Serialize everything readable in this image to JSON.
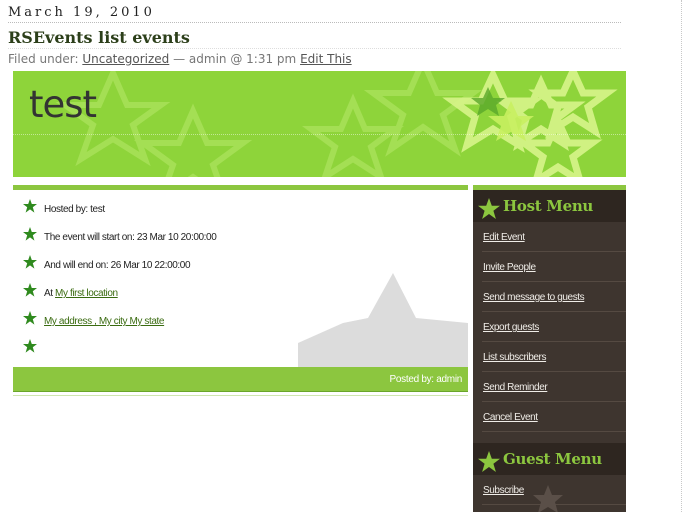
{
  "post": {
    "date": "March 19, 2010",
    "title": "RSEvents list events",
    "meta": {
      "filed_under": "Filed under:",
      "category": "Uncategorized",
      "sep": "— admin @ 1:31 pm",
      "edit": "Edit This"
    }
  },
  "event": {
    "title": "test",
    "details": [
      {
        "text": "Hosted by: test",
        "link": ""
      },
      {
        "text": "The event will start on: 23 Mar 10 20:00:00",
        "link": ""
      },
      {
        "text": "And will end on: 26 Mar 10 22:00:00",
        "link": ""
      },
      {
        "text": "At ",
        "link": "My first location"
      },
      {
        "text": "",
        "link": "My address , My city My state"
      },
      {
        "text": "",
        "link": ""
      }
    ],
    "posted_by": "Posted by: admin"
  },
  "host_menu": {
    "title": "Host Menu",
    "items": [
      "Edit Event",
      "Invite People",
      "Send message to guests",
      "Export guests",
      "List subscribers",
      "Send Reminder",
      "Cancel Event"
    ]
  },
  "guest_menu": {
    "title": "Guest Menu",
    "items": [
      "Subscribe"
    ]
  },
  "colors": {
    "accent_green": "#8cc63f",
    "sidebar_brown": "#3e352f",
    "title_text": "#2c3f1a"
  }
}
